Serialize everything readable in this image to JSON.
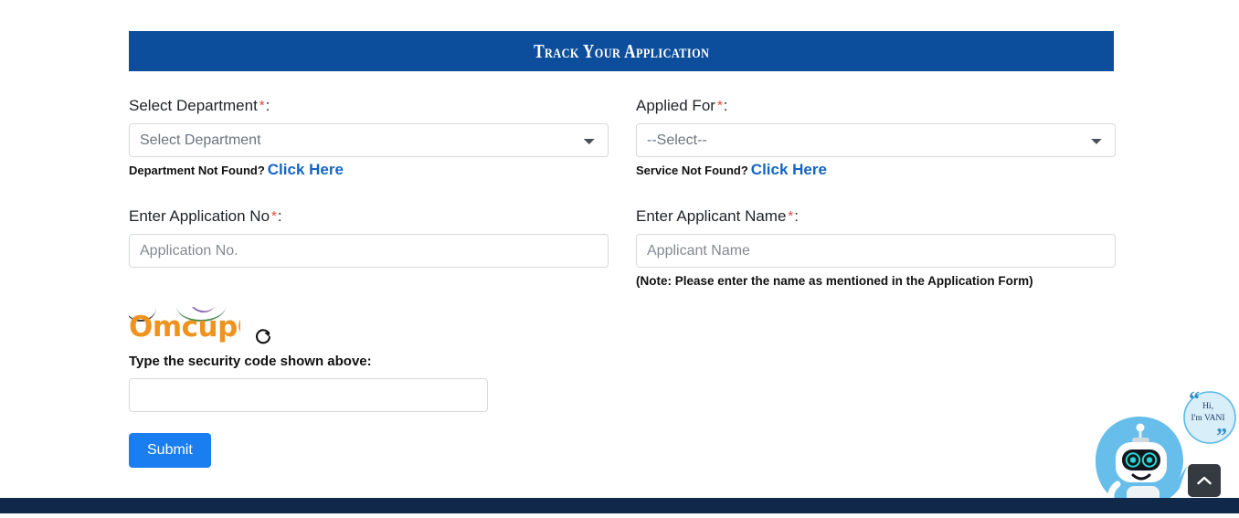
{
  "banner": {
    "title": "Track Your Application"
  },
  "form": {
    "department": {
      "label": "Select Department",
      "required_mark": "*",
      "colon": ":",
      "selected": "Select Department",
      "options": [
        "Select Department"
      ],
      "helper_text": "Department Not Found?",
      "helper_link": "Click Here"
    },
    "applied_for": {
      "label": "Applied For",
      "required_mark": "*",
      "colon": ":",
      "selected": "--Select--",
      "options": [
        "--Select--"
      ],
      "helper_text": "Service Not Found?",
      "helper_link": "Click Here"
    },
    "application_no": {
      "label": "Enter Application No",
      "required_mark": "*",
      "colon": ":",
      "value": "",
      "placeholder": "Application No."
    },
    "applicant_name": {
      "label": "Enter Applicant Name",
      "required_mark": "*",
      "colon": ":",
      "value": "",
      "placeholder": "Applicant Name",
      "note": "(Note: Please enter the name as mentioned in the Application Form)"
    }
  },
  "captcha": {
    "code_text": "OmcupG",
    "refresh_icon": "refresh-icon",
    "prompt": "Type the security code shown above:",
    "value": "",
    "placeholder": ""
  },
  "actions": {
    "submit_label": "Submit"
  },
  "chatbot": {
    "name": "VANI",
    "greeting_line1": "Hi,",
    "greeting_line2": "I'm VANI",
    "avatar_icon": "robot-icon"
  },
  "scroll_top": {
    "icon": "chevron-up-icon"
  },
  "colors": {
    "banner_blue": "#0d4e9c",
    "link_blue": "#1565c0",
    "submit_blue": "#1a7ef0",
    "required_red": "#e8413a",
    "captcha_orange": "#f0921e",
    "footer_navy": "#10294a",
    "scroll_top_gray": "#343a40"
  }
}
